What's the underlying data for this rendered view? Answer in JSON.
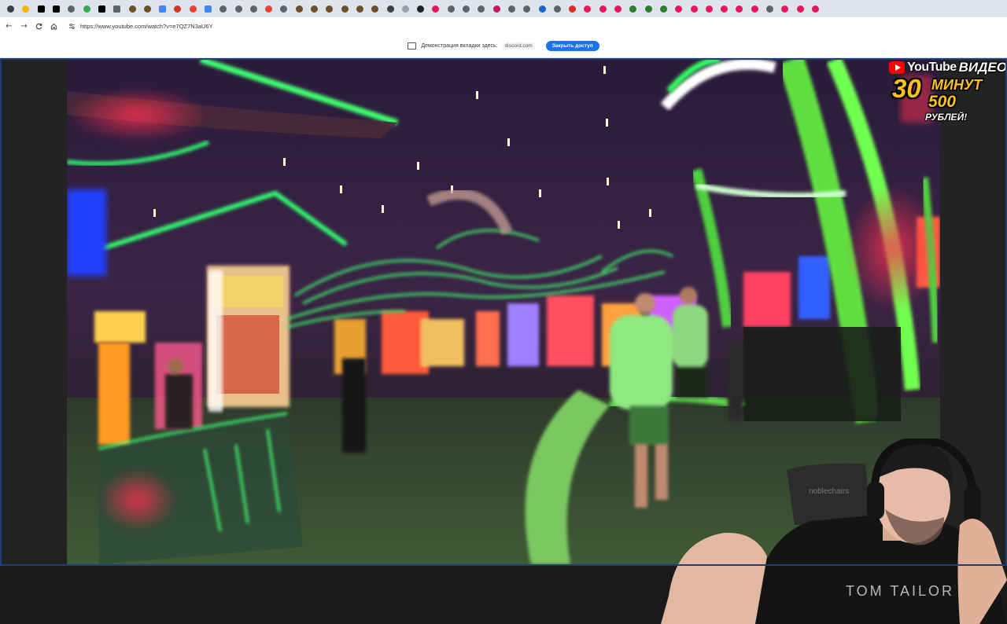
{
  "browser": {
    "tabs": [
      {
        "icon": "tab-icon",
        "color": "#3c4043"
      },
      {
        "icon": "tab-icon",
        "color": "#f4b400"
      },
      {
        "icon": "x-icon",
        "color": "#000000"
      },
      {
        "icon": "x-icon",
        "color": "#000000"
      },
      {
        "icon": "tab-icon",
        "color": "#5f6368"
      },
      {
        "icon": "tab-icon",
        "color": "#34a853"
      },
      {
        "icon": "x-icon",
        "color": "#000000"
      },
      {
        "icon": "gmail-icon",
        "color": "#5f6368"
      },
      {
        "icon": "tab-icon",
        "color": "#6b4f2a"
      },
      {
        "icon": "tab-icon",
        "color": "#6b4f2a"
      },
      {
        "icon": "docs-icon",
        "color": "#4285f4"
      },
      {
        "icon": "tab-icon",
        "color": "#d93025"
      },
      {
        "icon": "tab-icon",
        "color": "#ea4335"
      },
      {
        "icon": "google-icon",
        "color": "#4285f4"
      },
      {
        "icon": "tab-icon",
        "color": "#5f6368"
      },
      {
        "icon": "tab-icon",
        "color": "#5f6368"
      },
      {
        "icon": "tab-icon",
        "color": "#5f6368"
      },
      {
        "icon": "tab-icon",
        "color": "#ea4335"
      },
      {
        "icon": "tab-icon",
        "color": "#5f6368"
      },
      {
        "icon": "tab-icon",
        "color": "#6b4f2a"
      },
      {
        "icon": "tab-icon",
        "color": "#6b4f2a"
      },
      {
        "icon": "tab-icon",
        "color": "#6b4f2a"
      },
      {
        "icon": "tab-icon",
        "color": "#6b4f2a"
      },
      {
        "icon": "tab-icon",
        "color": "#6b4f2a"
      },
      {
        "icon": "tab-icon",
        "color": "#6b4f2a"
      },
      {
        "icon": "tab-icon",
        "color": "#3c4043"
      },
      {
        "icon": "tab-icon",
        "color": "#9aa0a6"
      },
      {
        "icon": "tab-icon",
        "color": "#202124"
      },
      {
        "icon": "tab-icon",
        "color": "#e8175d"
      },
      {
        "icon": "tab-icon",
        "color": "#5f6368"
      },
      {
        "icon": "tab-icon",
        "color": "#5f6368"
      },
      {
        "icon": "tab-icon",
        "color": "#5f6368"
      },
      {
        "icon": "tab-icon",
        "color": "#c2185b"
      },
      {
        "icon": "tab-icon",
        "color": "#5f6368"
      },
      {
        "icon": "tab-icon",
        "color": "#5f6368"
      },
      {
        "icon": "tab-icon",
        "color": "#1967d2"
      },
      {
        "icon": "tab-icon",
        "color": "#5f6368"
      },
      {
        "icon": "tab-icon",
        "color": "#d93025"
      },
      {
        "icon": "tab-icon",
        "color": "#e8175d"
      },
      {
        "icon": "tab-icon",
        "color": "#e8175d"
      },
      {
        "icon": "tab-icon",
        "color": "#e8175d"
      },
      {
        "icon": "tab-icon",
        "color": "#2e7d32"
      },
      {
        "icon": "tab-icon",
        "color": "#2e7d32"
      },
      {
        "icon": "tab-icon",
        "color": "#2e7d32"
      },
      {
        "icon": "tab-icon",
        "color": "#e8175d"
      },
      {
        "icon": "tab-icon",
        "color": "#e8175d"
      },
      {
        "icon": "tab-icon",
        "color": "#e8175d"
      },
      {
        "icon": "tab-icon",
        "color": "#e8175d"
      },
      {
        "icon": "tab-icon",
        "color": "#e8175d"
      },
      {
        "icon": "tab-icon",
        "color": "#e8175d"
      },
      {
        "icon": "tab-icon",
        "color": "#5f6368"
      },
      {
        "icon": "tab-icon",
        "color": "#e8175d"
      },
      {
        "icon": "tab-icon",
        "color": "#e8175d"
      },
      {
        "icon": "tab-icon",
        "color": "#e8175d"
      }
    ],
    "nav": {
      "back": "←",
      "forward": "→",
      "reload": "C",
      "home": "⌂"
    },
    "url": "https://www.youtube.com/watch?v=e7QZ7N3aU6Y"
  },
  "share_bar": {
    "text": "Демонстрация вкладки здесь:",
    "domain": "discord.com",
    "stop_label": "Закрыть доступ",
    "accent": "#1a73e8"
  },
  "promo": {
    "brand": "YouTube",
    "video_word": "ВИДЕО",
    "minutes_number": "30",
    "minutes_word": "МИНУТ",
    "price": "500",
    "currency": "РУБЛЕЙ!"
  },
  "webcam": {
    "shirt_text": "TOM TAILOR",
    "chair_text": "noblechairs"
  }
}
